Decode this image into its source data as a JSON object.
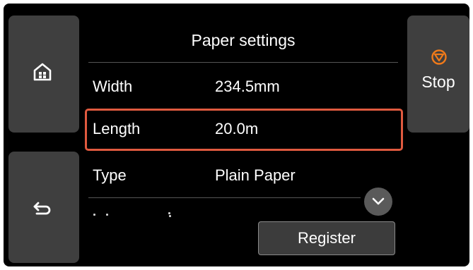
{
  "screen": {
    "title": "Paper settings"
  },
  "nav": {
    "home_icon": "home-icon",
    "back_icon": "back-arrow-icon"
  },
  "stop": {
    "label": "Stop",
    "icon": "stop-circle-icon",
    "icon_color": "#f07a1a"
  },
  "settings": {
    "rows": [
      {
        "label": "Width",
        "value": "234.5mm",
        "selected": false
      },
      {
        "label": "Length",
        "value": "20.0m",
        "selected": true
      },
      {
        "label": "Type",
        "value": "Plain Paper",
        "selected": false
      }
    ],
    "selected_border_color": "#e05a3f"
  },
  "scroll": {
    "icon": "chevron-down-icon"
  },
  "register": {
    "label": "Register"
  }
}
